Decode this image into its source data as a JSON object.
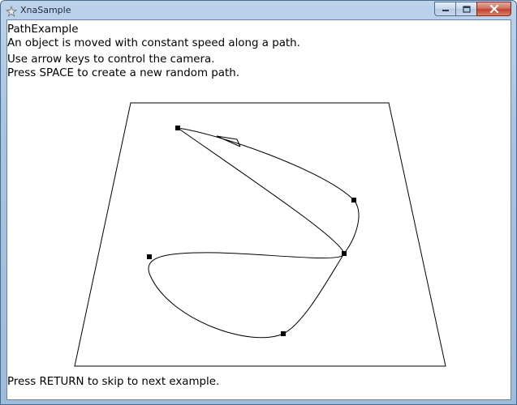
{
  "window": {
    "title": "XnaSample"
  },
  "content": {
    "heading": "PathExample",
    "line1": "An object is moved with constant speed along a path.",
    "line2": "Use arrow keys to control the camera.",
    "line3": "Press SPACE to create a new random path.",
    "footer": "Press RETURN to skip to next example."
  },
  "icons": {
    "app": "xna-app-icon",
    "minimize": "minimize-icon",
    "maximize": "maximize-icon",
    "close": "close-icon"
  },
  "colors": {
    "close_button": "#c8452f",
    "text": "#000000",
    "background": "#ffffff"
  }
}
